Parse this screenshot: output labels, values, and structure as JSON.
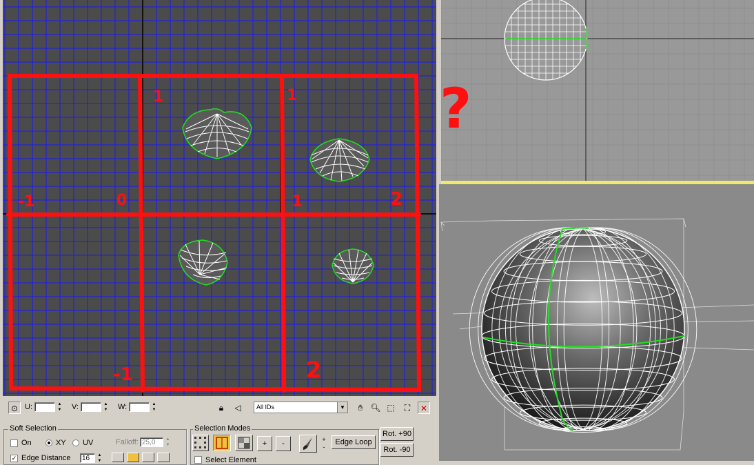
{
  "canvas": {
    "grid_labels": {
      "minus1_left": "-1",
      "zero": "0",
      "one_top_mid": "1",
      "one_top_right": "1",
      "one_bottom_right": "1",
      "two_right": "2",
      "minus1_bottom": "-1",
      "two_bottom": "2"
    },
    "question": "?"
  },
  "toolbar": {
    "u_label": "U:",
    "v_label": "V:",
    "w_label": "W:",
    "u_value": "",
    "v_value": "",
    "w_value": "",
    "id_select": "All IDs"
  },
  "soft_selection": {
    "title": "Soft Selection",
    "on_label": "On",
    "xy_label": "XY",
    "uv_label": "UV",
    "falloff_label": "Falloff:",
    "falloff_value": "25,0",
    "edge_distance_label": "Edge Distance",
    "edge_distance_value": "16"
  },
  "selection_modes": {
    "title": "Selection Modes",
    "plus_label": "+",
    "minus_label": "-",
    "edge_loop_label": "Edge Loop",
    "select_element_label": "Select Element"
  },
  "rotate": {
    "plus90": "Rot. +90",
    "minus90": "Rot. -90"
  },
  "colors": {
    "grid_line": "#1a1aff",
    "annotation_red": "#ff1010",
    "seam_green": "#22dd22",
    "viewport_active": "#f2e86a"
  }
}
